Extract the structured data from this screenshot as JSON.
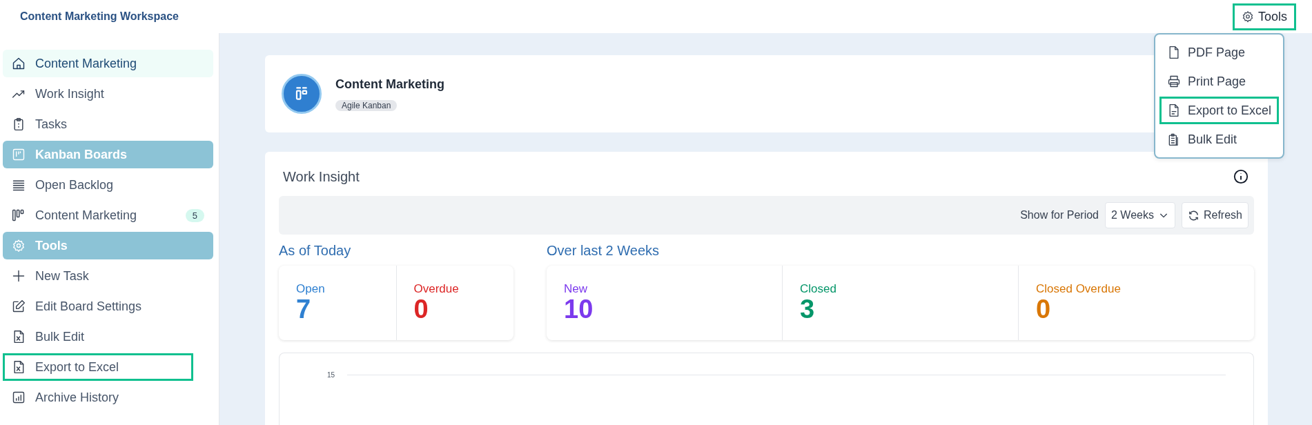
{
  "workspace_title": "Content Marketing Workspace",
  "tools_button": {
    "label": "Tools",
    "highlighted": true
  },
  "tools_menu": [
    {
      "label": "PDF Page",
      "highlighted": false
    },
    {
      "label": "Print Page",
      "highlighted": false
    },
    {
      "label": "Export to Excel",
      "highlighted": true
    },
    {
      "label": "Bulk Edit",
      "highlighted": false
    }
  ],
  "sidebar": {
    "items": [
      {
        "kind": "item",
        "label": "Content Marketing",
        "selected": true,
        "highlighted": false
      },
      {
        "kind": "item",
        "label": "Work Insight",
        "selected": false,
        "highlighted": false
      },
      {
        "kind": "item",
        "label": "Tasks",
        "selected": false,
        "highlighted": false
      },
      {
        "kind": "section",
        "label": "Kanban Boards",
        "selected": false,
        "highlighted": false
      },
      {
        "kind": "item",
        "label": "Open Backlog",
        "selected": false,
        "highlighted": false
      },
      {
        "kind": "item",
        "label": "Content Marketing",
        "selected": false,
        "highlighted": false,
        "badge": "5"
      },
      {
        "kind": "section",
        "label": "Tools",
        "selected": false,
        "highlighted": false
      },
      {
        "kind": "item",
        "label": "New Task",
        "selected": false,
        "highlighted": false
      },
      {
        "kind": "item",
        "label": "Edit Board Settings",
        "selected": false,
        "highlighted": false
      },
      {
        "kind": "item",
        "label": "Bulk Edit",
        "selected": false,
        "highlighted": false
      },
      {
        "kind": "item",
        "label": "Export to Excel",
        "selected": false,
        "highlighted": true
      },
      {
        "kind": "item",
        "label": "Archive History",
        "selected": false,
        "highlighted": false
      }
    ]
  },
  "board": {
    "title": "Content Marketing",
    "tag": "Agile Kanban"
  },
  "work_insight": {
    "title": "Work Insight",
    "period_label": "Show for Period",
    "period_value": "2 Weeks",
    "refresh": "Refresh",
    "groups": [
      {
        "title": "As of Today",
        "stats": [
          {
            "label": "Open",
            "value": "7",
            "color": "#2f80d1"
          },
          {
            "label": "Overdue",
            "value": "0",
            "color": "#dc2626"
          }
        ]
      },
      {
        "title": "Over last 2 Weeks",
        "stats": [
          {
            "label": "New",
            "value": "10",
            "color": "#7c3aed"
          },
          {
            "label": "Closed",
            "value": "3",
            "color": "#059669"
          },
          {
            "label": "Closed Overdue",
            "value": "0",
            "color": "#d97706"
          }
        ]
      }
    ],
    "chart_tick": "15"
  }
}
